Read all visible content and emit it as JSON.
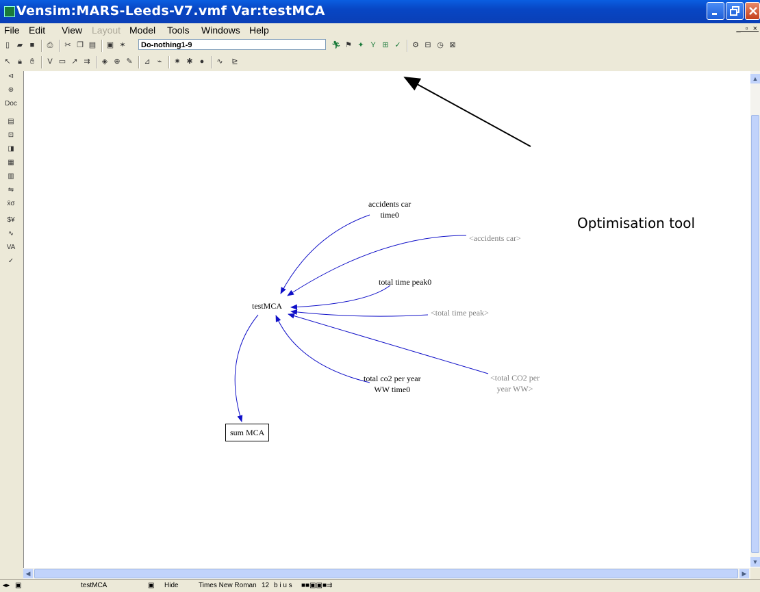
{
  "window": {
    "title": "Vensim:MARS-Leeds-V7.vmf Var:testMCA"
  },
  "menu": [
    "File",
    "Edit",
    "View",
    "Layout",
    "Model",
    "Tools",
    "Windows",
    "Help"
  ],
  "toolbar": {
    "simulation_name": "Do-nothing1-9"
  },
  "diagram": {
    "vars": {
      "accidents_car_time0": "accidents car\ntime0",
      "accidents_car_shadow": "<accidents car>",
      "total_time_peak0": "total time peak0",
      "testMCA": "testMCA",
      "total_time_peak_shadow": "<total time peak>",
      "total_co2": "total co2 per year\nWW time0",
      "total_co2_shadow": "<total CO2 per\nyear WW>",
      "sum_mca": "sum MCA"
    },
    "arrow_color": "#1010c8"
  },
  "annotation": {
    "text": "Optimisation tool"
  },
  "status": {
    "variable": "testMCA",
    "hide": "Hide",
    "font": "Times New Roman",
    "size": "12",
    "styles": "b i u s"
  }
}
